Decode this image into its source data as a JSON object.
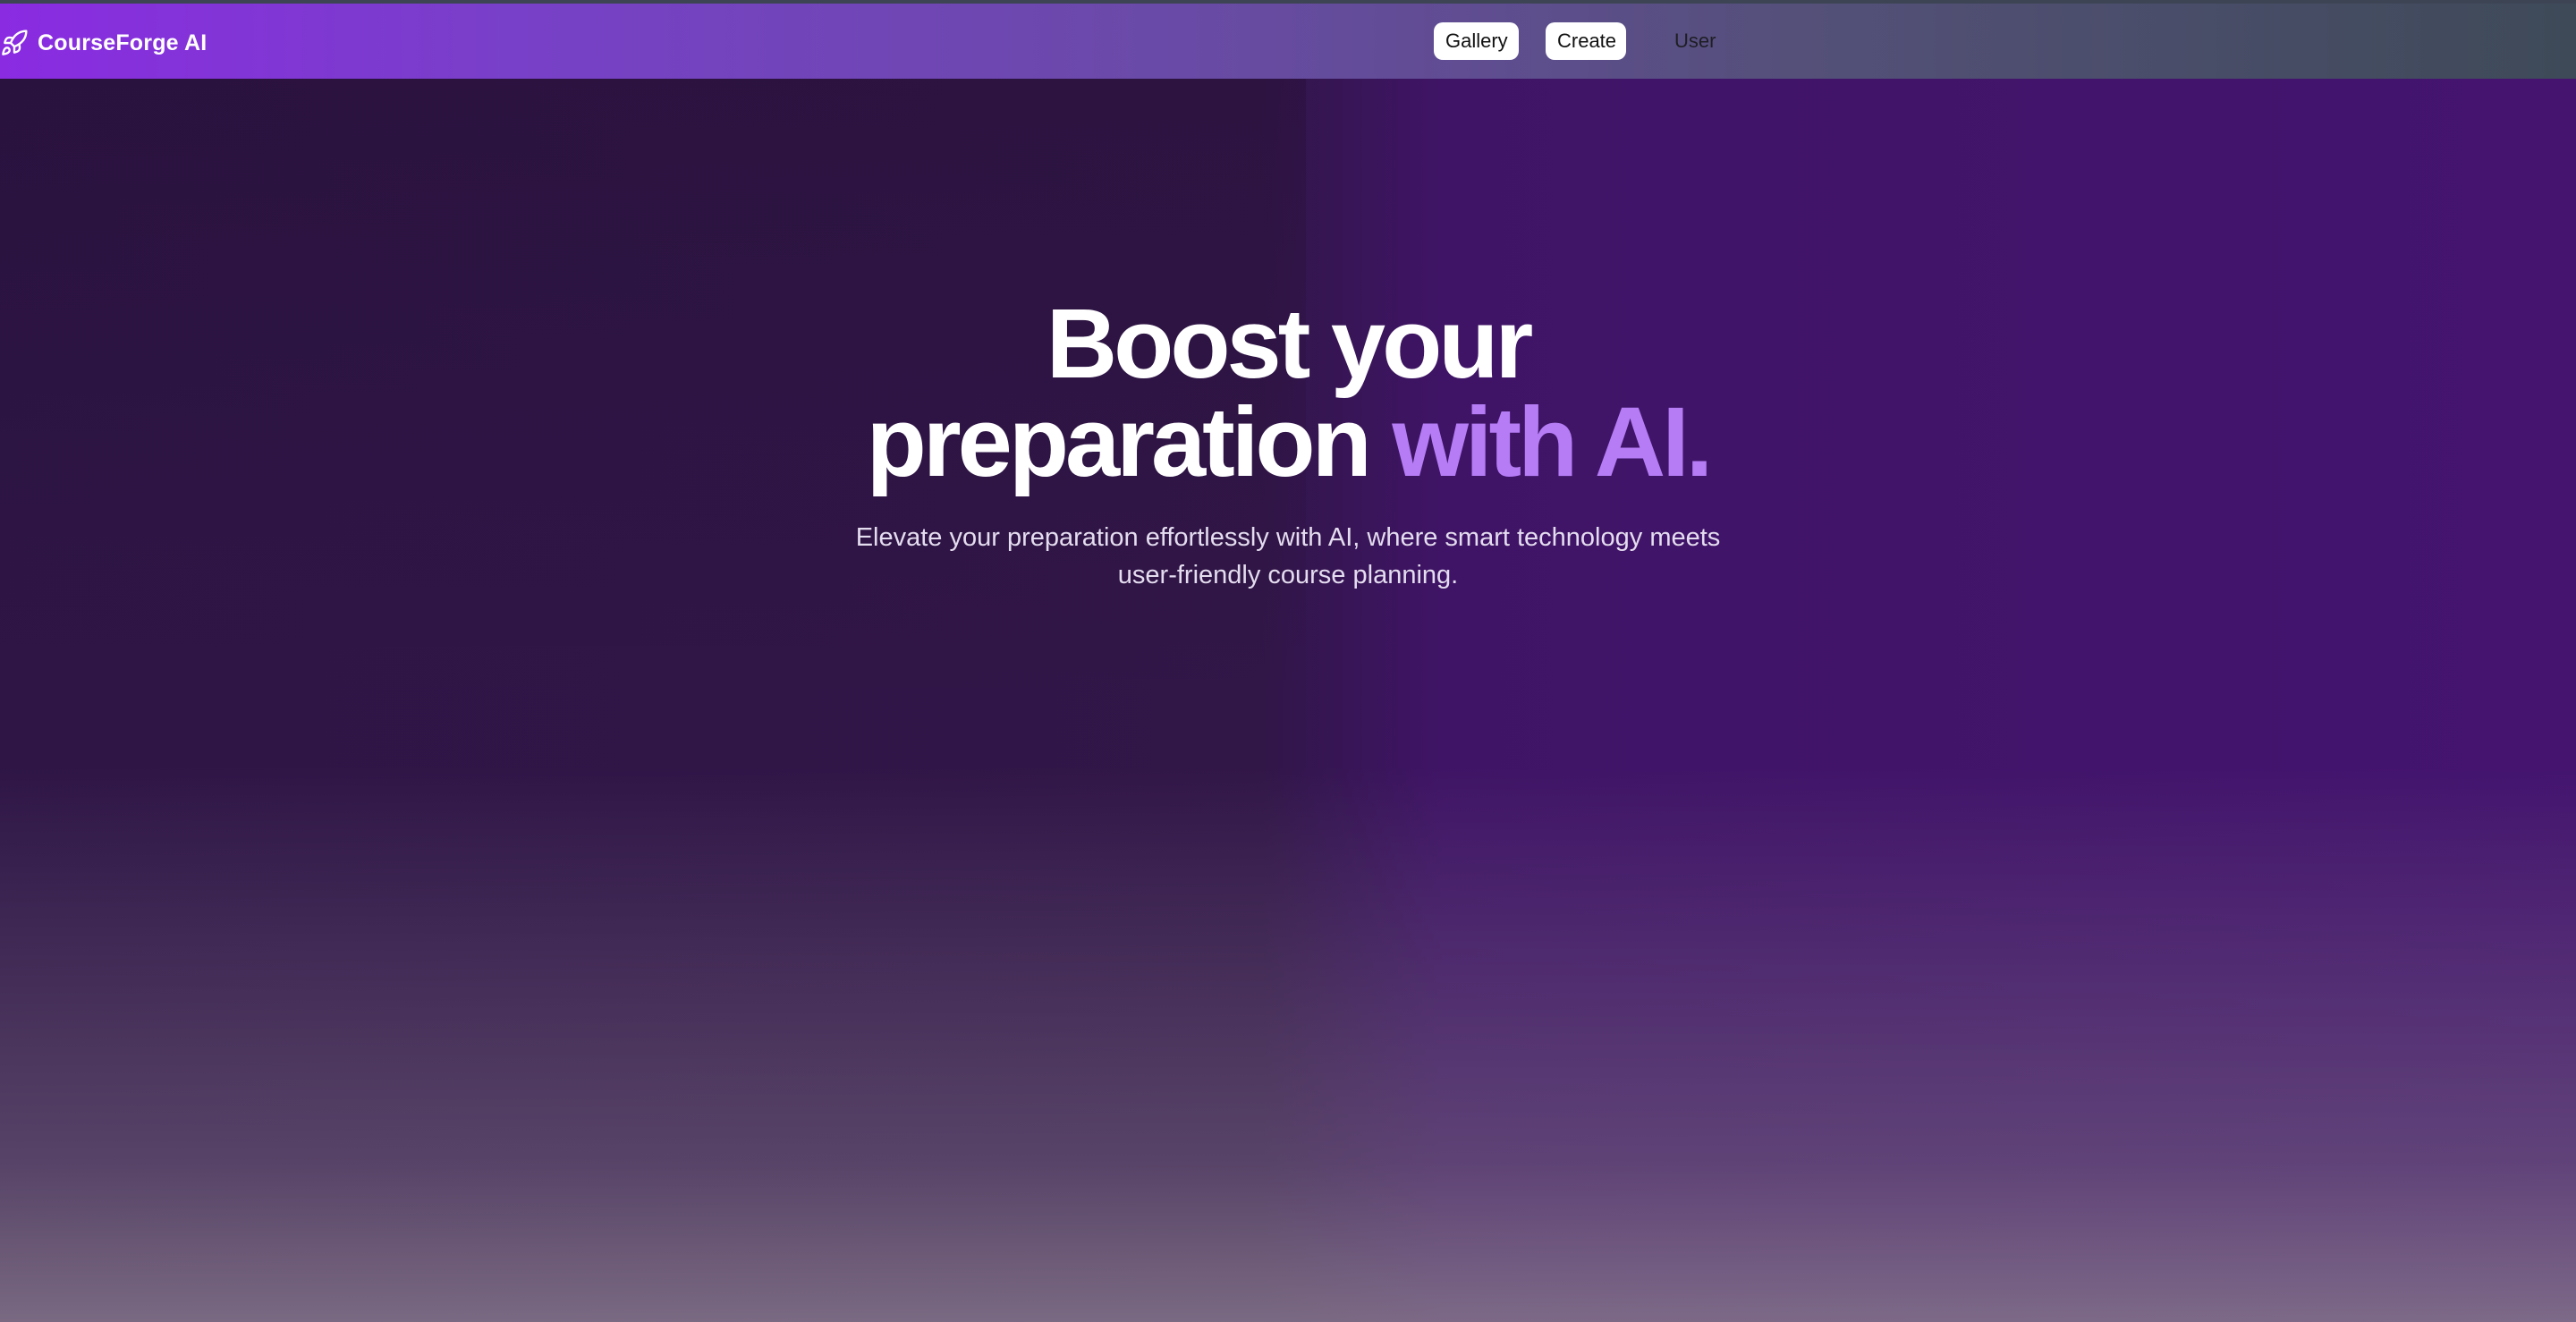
{
  "brand": {
    "name": "CourseForge AI",
    "icon": "rocket-icon"
  },
  "nav": {
    "gallery_label": "Gallery",
    "create_label": "Create",
    "user_label": "User"
  },
  "hero": {
    "title_line1": "Boost your",
    "title_line2_plain": "preparation ",
    "title_line2_accent": "with AI.",
    "subtitle_line1": "Elevate your preparation effortlessly with AI, where smart technology meets",
    "subtitle_line2": "user-friendly course planning."
  },
  "colors": {
    "accent": "#b57cf5",
    "nav_gradient_start": "#8a2be2",
    "nav_gradient_end": "#3e4a58",
    "background": "#3f1466"
  }
}
